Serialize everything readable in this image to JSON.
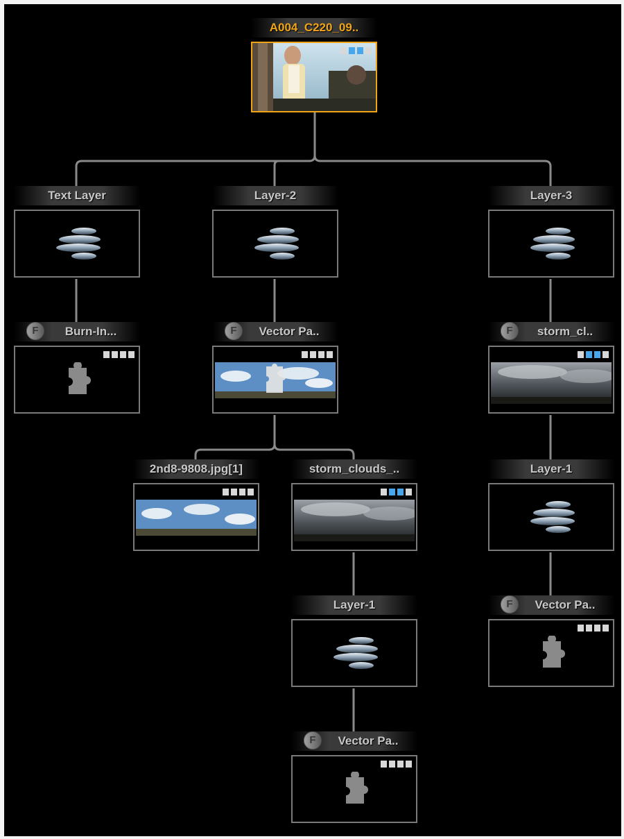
{
  "root": {
    "title": "A004_C220_09.."
  },
  "text_layer": {
    "title": "Text Layer"
  },
  "layer2": {
    "title": "Layer-2"
  },
  "layer3": {
    "title": "Layer-3"
  },
  "burnin": {
    "title": "Burn-In..."
  },
  "vector_pa_1": {
    "title": "Vector Pa.."
  },
  "storm_cl": {
    "title": "storm_cl.."
  },
  "jpg_node": {
    "title": "2nd8-9808.jpg[1]"
  },
  "storm_clouds": {
    "title": "storm_clouds_.."
  },
  "layer1_right": {
    "title": "Layer-1"
  },
  "layer1_mid": {
    "title": "Layer-1"
  },
  "vector_pa_right": {
    "title": "Vector Pa.."
  },
  "vector_pa_bottom": {
    "title": "Vector Pa.."
  },
  "badge_label": "F",
  "colors": {
    "selected": "#f0a418",
    "wire": "#8a8a8a",
    "channel_active": "#4aa6ea"
  }
}
